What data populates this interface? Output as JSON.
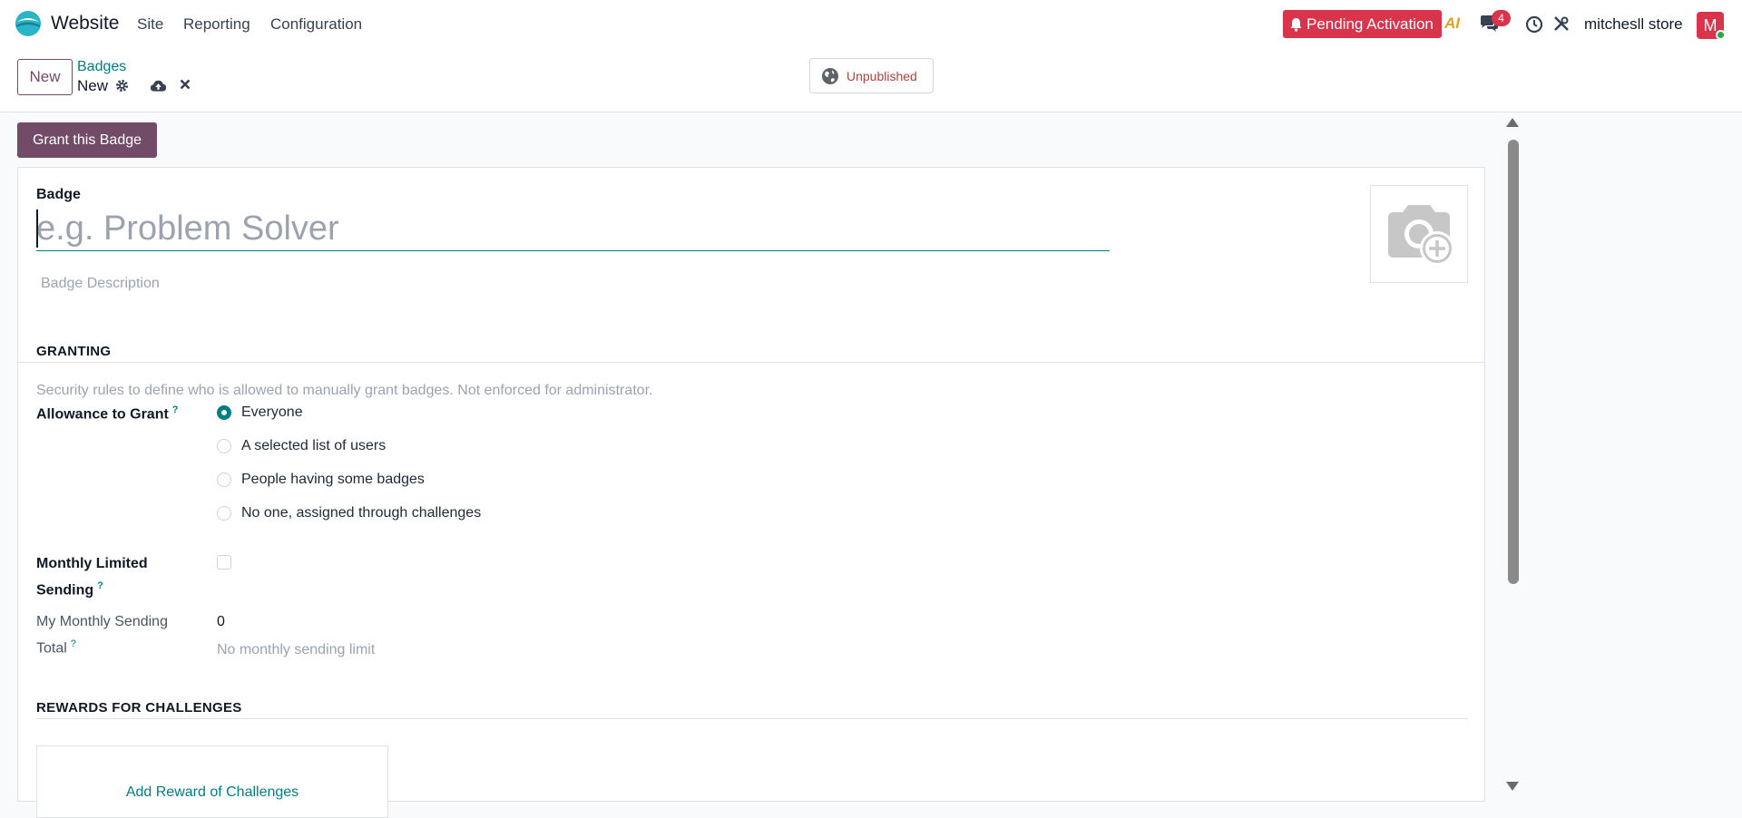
{
  "colors": {
    "brand": "#714b67",
    "accent": "#017e84",
    "danger": "#d9344b",
    "unpublished": "#b3413d"
  },
  "navbar": {
    "app_name": "Website",
    "menu": [
      "Site",
      "Reporting",
      "Configuration"
    ],
    "pending_label": "Pending Activation",
    "ai_label": "AI",
    "chat_count": "4",
    "store_name": "mitchesll store",
    "avatar_letter": "M"
  },
  "control": {
    "new_label": "New",
    "breadcrumb_parent": "Badges",
    "breadcrumb_current": "New",
    "unpublished_label": "Unpublished"
  },
  "actions": {
    "grant_label": "Grant this Badge"
  },
  "form": {
    "badge_label": "Badge",
    "badge_placeholder": "e.g. Problem Solver",
    "badge_value": "",
    "description_placeholder": "Badge Description",
    "granting_title": "GRANTING",
    "granting_help": "Security rules to define who is allowed to manually grant badges. Not enforced for administrator.",
    "allowance_label": "Allowance to Grant",
    "help_mark": "?",
    "allowance_options": [
      {
        "label": "Everyone",
        "selected": true
      },
      {
        "label": "A selected list of users",
        "selected": false
      },
      {
        "label": "People having some badges",
        "selected": false
      },
      {
        "label": "No one, assigned through challenges",
        "selected": false
      }
    ],
    "monthly_label_line1": "Monthly Limited",
    "monthly_label_line2": "Sending",
    "monthly_checked": false,
    "sending_total_line1": "My Monthly Sending",
    "sending_total_line2": "Total",
    "sending_total_value": "0",
    "no_limit_text": "No monthly sending limit",
    "rewards_title": "REWARDS FOR CHALLENGES",
    "add_reward_label": "Add Reward of Challenges"
  }
}
